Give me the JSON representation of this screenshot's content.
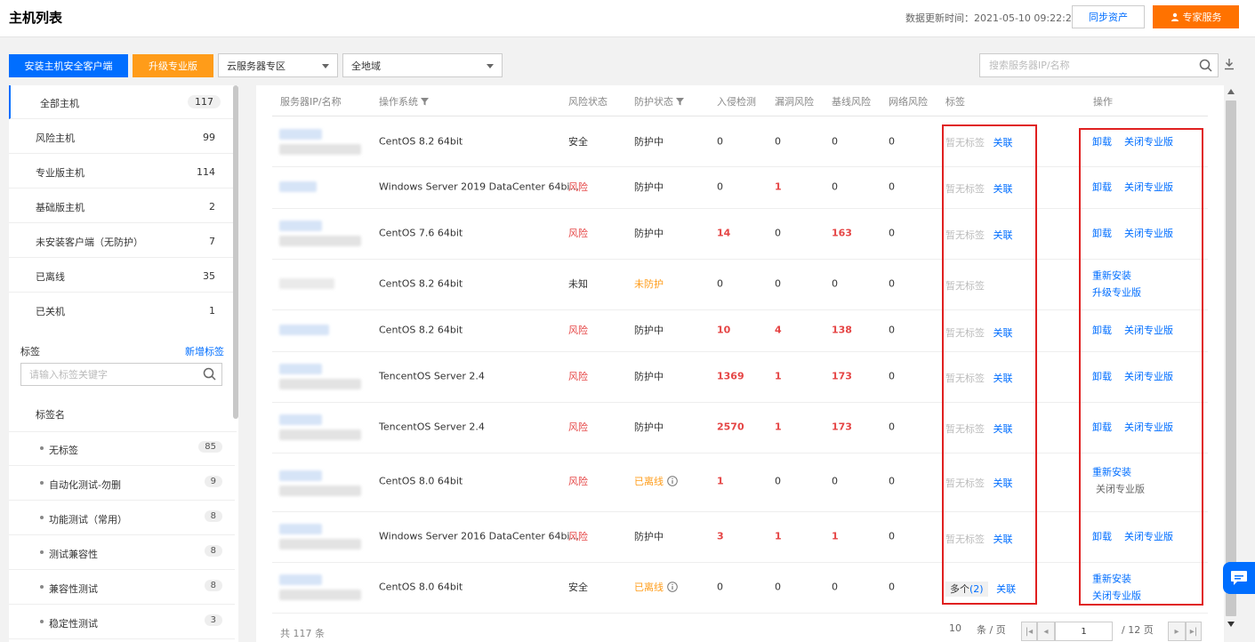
{
  "header": {
    "title": "主机列表",
    "update_time": "数据更新时间：2021-05-10 09:22:24",
    "sync_label": "同步资产",
    "expert_label": "专家服务"
  },
  "toolbar": {
    "install_label": "安装主机安全客户端",
    "upgrade_label": "升级专业版",
    "zone_select": "云服务器专区",
    "region_select": "全地域",
    "search_placeholder": "搜索服务器IP/名称"
  },
  "sidebar": {
    "hosts": [
      {
        "label": "全部主机",
        "count": "117"
      },
      {
        "label": "风险主机",
        "count": "99"
      },
      {
        "label": "专业版主机",
        "count": "114"
      },
      {
        "label": "基础版主机",
        "count": "2"
      },
      {
        "label": "未安装客户端（无防护）",
        "count": "7"
      },
      {
        "label": "已离线",
        "count": "35"
      },
      {
        "label": "已关机",
        "count": "1"
      }
    ],
    "tag_title": "标签",
    "tag_add": "新增标签",
    "tag_search_placeholder": "请输入标签关键字",
    "tag_name_header": "标签名",
    "tags": [
      {
        "label": "无标签",
        "count": "85"
      },
      {
        "label": "自动化测试-勿删",
        "count": "9"
      },
      {
        "label": "功能测试（常用）",
        "count": "8"
      },
      {
        "label": "测试兼容性",
        "count": "8"
      },
      {
        "label": "兼容性测试",
        "count": "8"
      },
      {
        "label": "稳定性测试",
        "count": "3"
      }
    ]
  },
  "table": {
    "columns": {
      "server": "服务器IP/名称",
      "os": "操作系统",
      "risk": "风险状态",
      "protect": "防护状态",
      "intrusion": "入侵检测",
      "vuln": "漏洞风险",
      "baseline": "基线风险",
      "network": "网络风险",
      "tags": "标签",
      "ops": "操作"
    },
    "rows": [
      {
        "os": "CentOS 8.2 64bit",
        "risk": "安全",
        "protect": "防护中",
        "intrusion": "0",
        "vuln": "0",
        "baseline": "0",
        "network": "0",
        "tag": "暂无标签",
        "tag_link": "关联",
        "op1": "卸载",
        "op2": "关闭专业版"
      },
      {
        "os": "Windows Server 2019 DataCenter 64bi...",
        "risk": "风险",
        "protect": "防护中",
        "intrusion": "0",
        "vuln": "1",
        "baseline": "0",
        "network": "0",
        "tag": "暂无标签",
        "tag_link": "关联",
        "op1": "卸载",
        "op2": "关闭专业版"
      },
      {
        "os": "CentOS 7.6 64bit",
        "risk": "风险",
        "protect": "防护中",
        "intrusion": "14",
        "vuln": "0",
        "baseline": "163",
        "network": "0",
        "tag": "暂无标签",
        "tag_link": "关联",
        "op1": "卸载",
        "op2": "关闭专业版"
      },
      {
        "os": "CentOS 8.2 64bit",
        "risk": "未知",
        "protect": "未防护",
        "intrusion": "0",
        "vuln": "0",
        "baseline": "0",
        "network": "0",
        "tag": "暂无标签",
        "op1": "重新安装",
        "op2": "升级专业版"
      },
      {
        "os": "CentOS 8.2 64bit",
        "risk": "风险",
        "protect": "防护中",
        "intrusion": "10",
        "vuln": "4",
        "baseline": "138",
        "network": "0",
        "tag": "暂无标签",
        "tag_link": "关联",
        "op1": "卸载",
        "op2": "关闭专业版"
      },
      {
        "os": "TencentOS Server 2.4",
        "risk": "风险",
        "protect": "防护中",
        "intrusion": "1369",
        "vuln": "1",
        "baseline": "173",
        "network": "0",
        "tag": "暂无标签",
        "tag_link": "关联",
        "op1": "卸载",
        "op2": "关闭专业版"
      },
      {
        "os": "TencentOS Server 2.4",
        "risk": "风险",
        "protect": "防护中",
        "intrusion": "2570",
        "vuln": "1",
        "baseline": "173",
        "network": "0",
        "tag": "暂无标签",
        "tag_link": "关联",
        "op1": "卸载",
        "op2": "关闭专业版"
      },
      {
        "os": "CentOS 8.0 64bit",
        "risk": "风险",
        "protect": "已离线",
        "intrusion": "1",
        "vuln": "0",
        "baseline": "0",
        "network": "0",
        "tag": "暂无标签",
        "tag_link": "关联",
        "op1": "重新安装",
        "op2": "关闭专业版"
      },
      {
        "os": "Windows Server 2016 DataCenter 64bi...",
        "risk": "风险",
        "protect": "防护中",
        "intrusion": "3",
        "vuln": "1",
        "baseline": "1",
        "network": "0",
        "tag": "暂无标签",
        "tag_link": "关联",
        "op1": "卸载",
        "op2": "关闭专业版"
      },
      {
        "os": "CentOS 8.0 64bit",
        "risk": "安全",
        "protect": "已离线",
        "intrusion": "0",
        "vuln": "0",
        "baseline": "0",
        "network": "0",
        "tag": "多个",
        "tag_count": "(2)",
        "tag_link": "关联",
        "op1": "重新安装",
        "op2": "关闭专业版"
      }
    ]
  },
  "pagination": {
    "total": "共 117 条",
    "page_size": "10",
    "per_page_label": "条 / 页",
    "current_page": "1",
    "total_pages": "/ 12 页"
  },
  "colors": {
    "primary": "#006eff",
    "accent_orange": "#ff7200",
    "risk_red": "#e54545",
    "warning_orange": "#ff9c19",
    "highlight_box": "#e02020"
  }
}
